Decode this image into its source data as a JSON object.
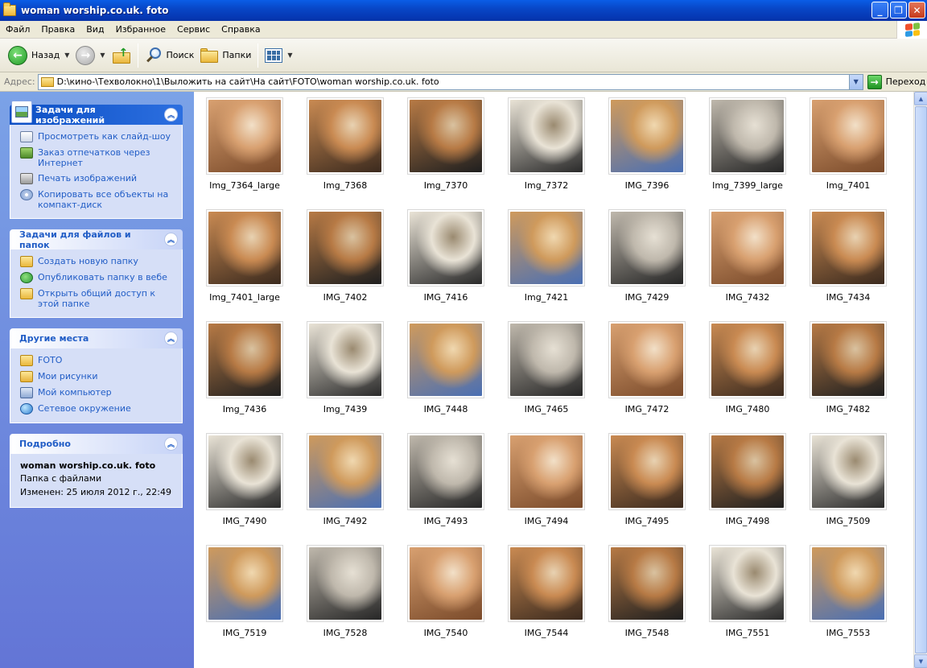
{
  "window": {
    "title": "woman worship.co.uk. foto",
    "colors": {
      "titlebar": "#0a5de6",
      "taskpane": "#7ba2e7",
      "link": "#215dc6"
    }
  },
  "menu": [
    "Файл",
    "Правка",
    "Вид",
    "Избранное",
    "Сервис",
    "Справка"
  ],
  "toolbar": {
    "back_label": "Назад",
    "search_label": "Поиск",
    "folders_label": "Папки"
  },
  "address": {
    "label": "Адрес:",
    "path": "D:\\кино-\\Техволокно\\1\\Выложить на сайт\\На сайт\\FOTO\\woman worship.co.uk. foto",
    "go_label": "Переход"
  },
  "taskpane": {
    "image_tasks": {
      "title": "Задачи для изображений",
      "items": [
        {
          "icon": "slideshow-icon",
          "label": "Просмотреть как слайд-шоу"
        },
        {
          "icon": "order-prints-icon",
          "label": "Заказ отпечатков через Интернет"
        },
        {
          "icon": "print-icon",
          "label": "Печать изображений"
        },
        {
          "icon": "cd-icon",
          "label": "Копировать все объекты на компакт-диск"
        }
      ]
    },
    "file_tasks": {
      "title": "Задачи для файлов и папок",
      "items": [
        {
          "icon": "new-folder-icon",
          "label": "Создать новую папку"
        },
        {
          "icon": "publish-web-icon",
          "label": "Опубликовать папку в вебе"
        },
        {
          "icon": "share-folder-icon",
          "label": "Открыть общий доступ к этой папке"
        }
      ]
    },
    "other_places": {
      "title": "Другие места",
      "items": [
        {
          "icon": "folder-icon",
          "label": "FOTO"
        },
        {
          "icon": "my-pictures-icon",
          "label": "Мои рисунки"
        },
        {
          "icon": "my-computer-icon",
          "label": "Мой компьютер"
        },
        {
          "icon": "network-icon",
          "label": "Сетевое окружение"
        }
      ]
    },
    "details": {
      "title": "Подробно",
      "name": "woman worship.co.uk. foto",
      "type": "Папка с файлами",
      "modified": "Изменен: 25 июля 2012 г., 22:49"
    }
  },
  "files": [
    "Img_7364_large",
    "Img_7368",
    "Img_7370",
    "Img_7372",
    "IMG_7396",
    "Img_7399_large",
    "Img_7401",
    "Img_7401_large",
    "IMG_7402",
    "IMG_7416",
    "Img_7421",
    "IMG_7429",
    "IMG_7432",
    "IMG_7434",
    "Img_7436",
    "Img_7439",
    "IMG_7448",
    "IMG_7465",
    "IMG_7472",
    "IMG_7480",
    "IMG_7482",
    "IMG_7490",
    "IMG_7492",
    "IMG_7493",
    "IMG_7494",
    "IMG_7495",
    "IMG_7498",
    "IMG_7509",
    "IMG_7519",
    "IMG_7528",
    "IMG_7540",
    "IMG_7544",
    "IMG_7548",
    "IMG_7551",
    "IMG_7553"
  ]
}
